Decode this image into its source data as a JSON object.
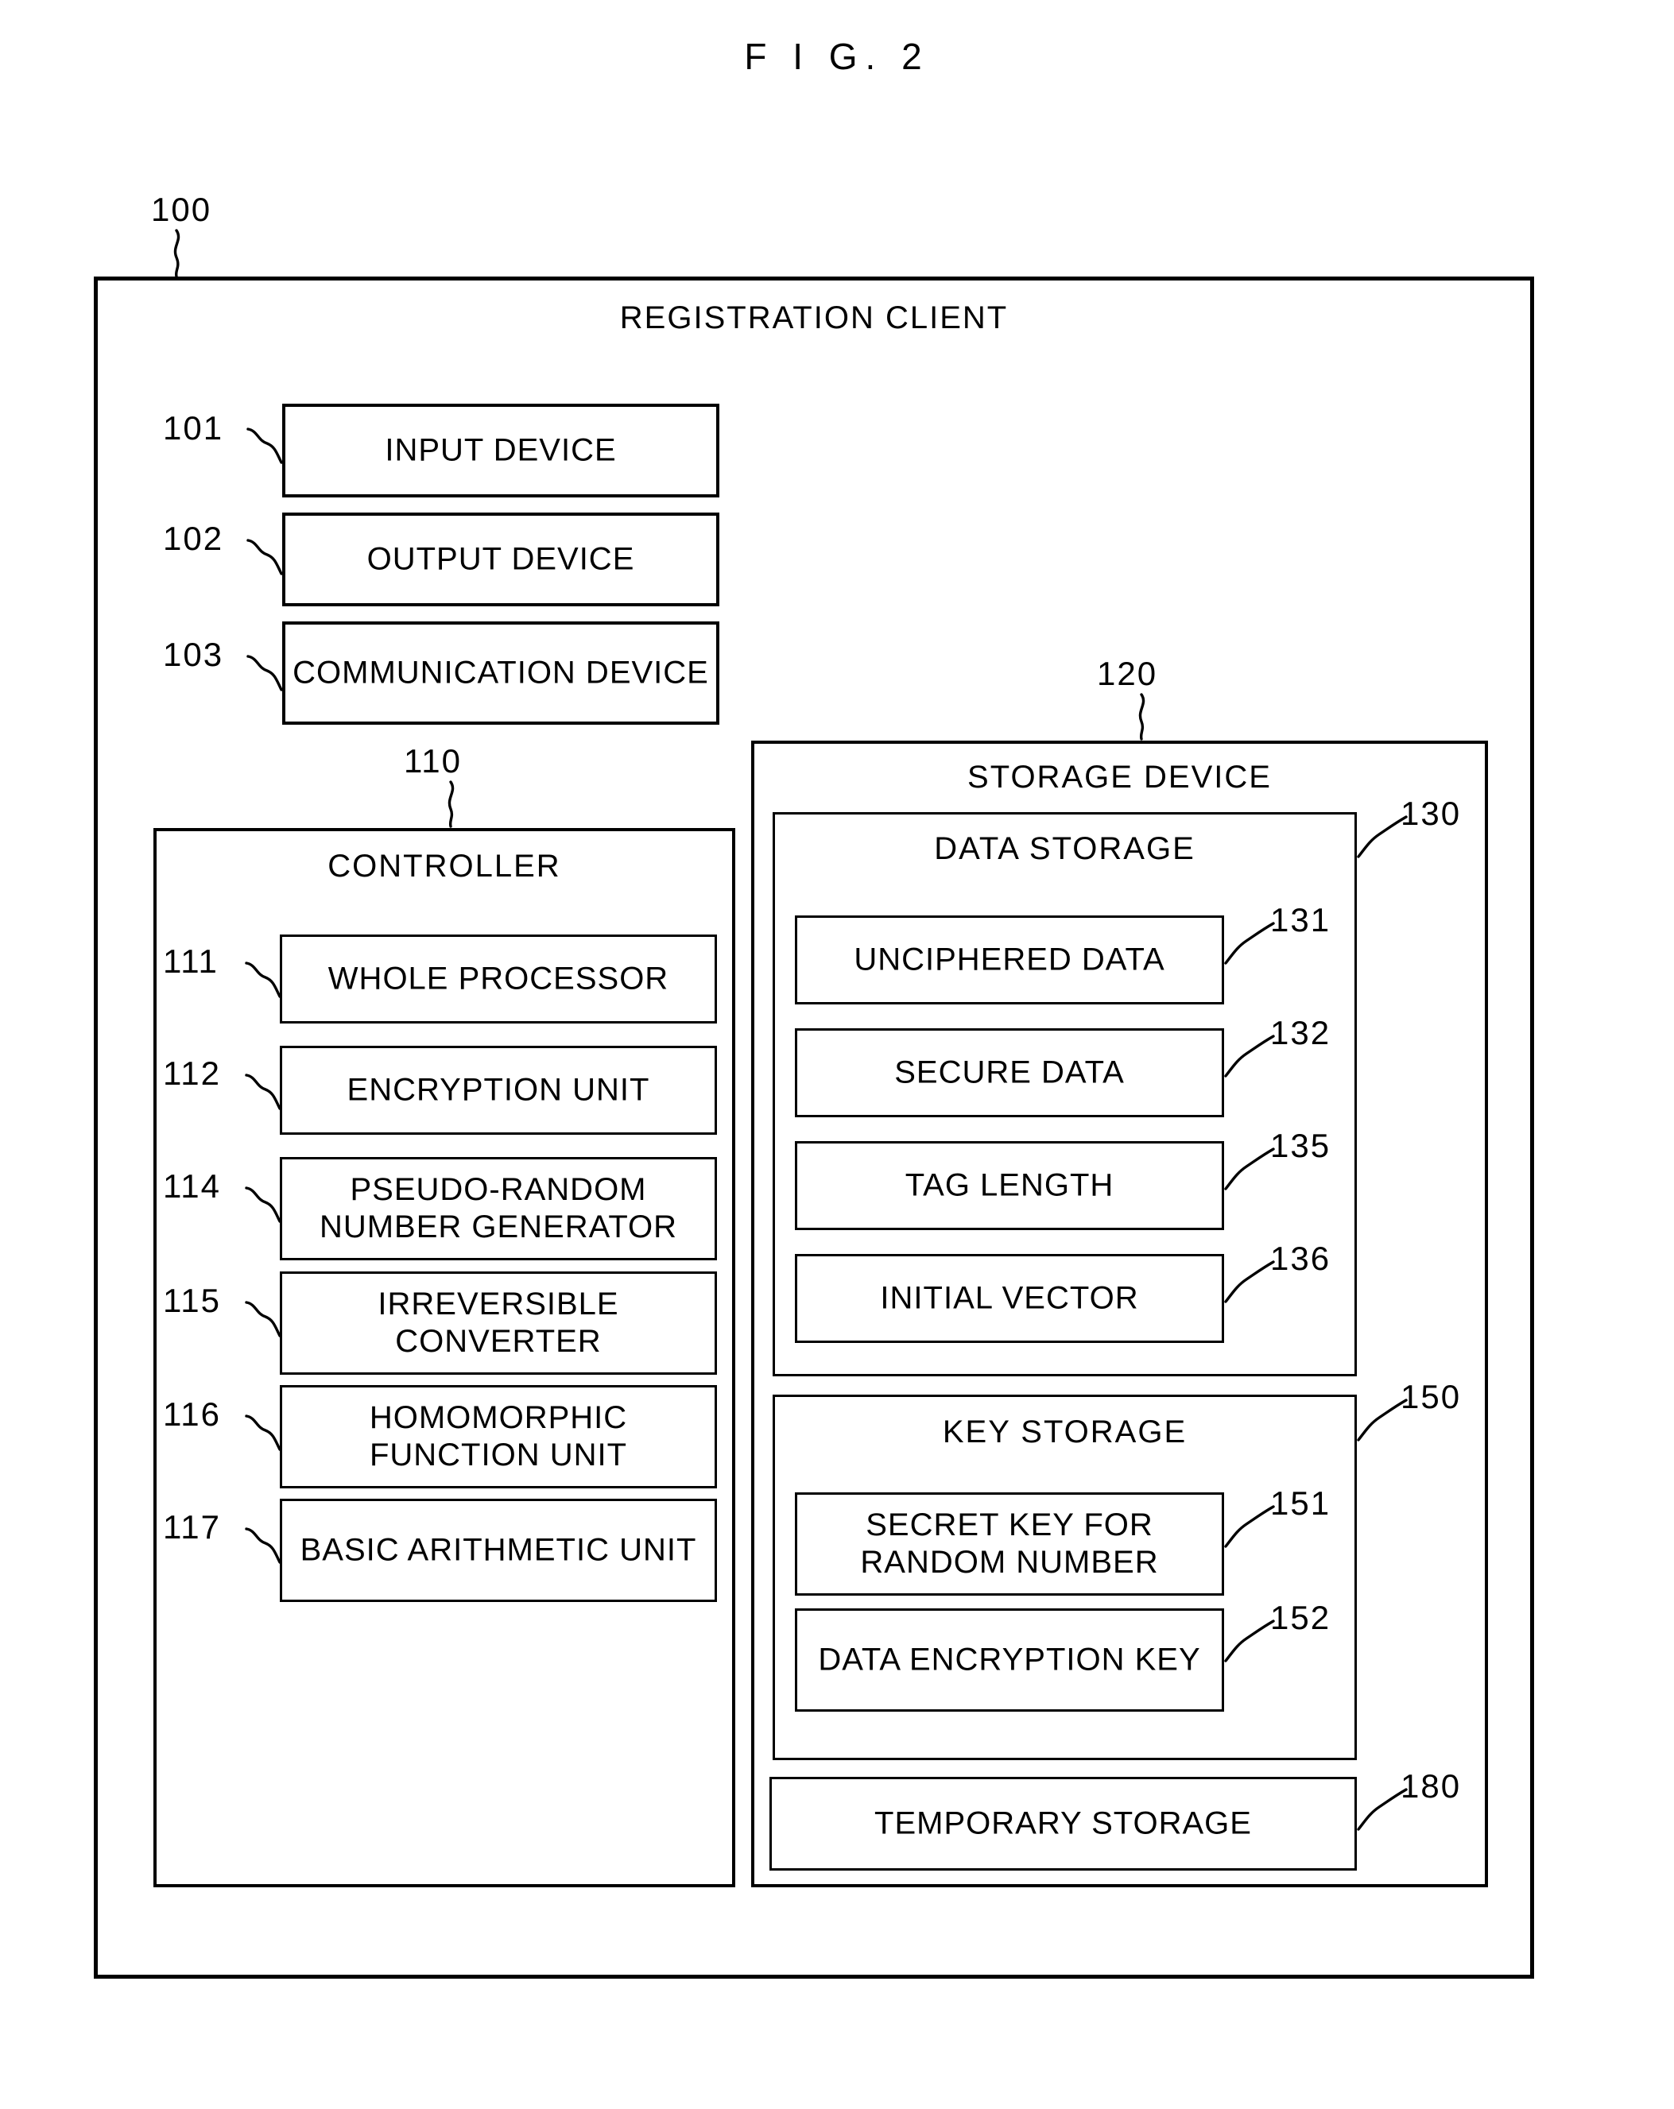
{
  "figure": {
    "title": "F I G. 2"
  },
  "outer": {
    "ref": "100",
    "title": "REGISTRATION CLIENT"
  },
  "peripherals": [
    {
      "ref": "101",
      "label": "INPUT DEVICE"
    },
    {
      "ref": "102",
      "label": "OUTPUT DEVICE"
    },
    {
      "ref": "103",
      "label": "COMMUNICATION DEVICE"
    }
  ],
  "controller": {
    "ref": "110",
    "title": "CONTROLLER",
    "units": [
      {
        "ref": "111",
        "label": "WHOLE PROCESSOR"
      },
      {
        "ref": "112",
        "label": "ENCRYPTION UNIT"
      },
      {
        "ref": "114",
        "label": "PSEUDO-RANDOM NUMBER GENERATOR"
      },
      {
        "ref": "115",
        "label": "IRREVERSIBLE CONVERTER"
      },
      {
        "ref": "116",
        "label": "HOMOMORPHIC FUNCTION UNIT"
      },
      {
        "ref": "117",
        "label": "BASIC ARITHMETIC UNIT"
      }
    ]
  },
  "storage_device": {
    "ref": "120",
    "title": "STORAGE DEVICE",
    "data_storage": {
      "ref": "130",
      "title": "DATA STORAGE",
      "items": [
        {
          "ref": "131",
          "label": "UNCIPHERED DATA"
        },
        {
          "ref": "132",
          "label": "SECURE DATA"
        },
        {
          "ref": "135",
          "label": "TAG LENGTH"
        },
        {
          "ref": "136",
          "label": "INITIAL VECTOR"
        }
      ]
    },
    "key_storage": {
      "ref": "150",
      "title": "KEY STORAGE",
      "items": [
        {
          "ref": "151",
          "label": "SECRET KEY FOR RANDOM NUMBER"
        },
        {
          "ref": "152",
          "label": "DATA ENCRYPTION KEY"
        }
      ]
    },
    "temporary_storage": {
      "ref": "180",
      "label": "TEMPORARY STORAGE"
    }
  }
}
